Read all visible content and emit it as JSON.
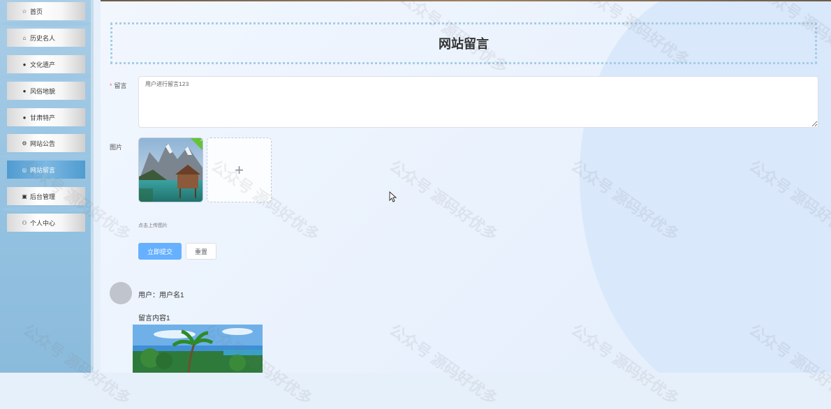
{
  "sidebar": {
    "items": [
      {
        "icon": "star-icon",
        "glyph": "☆",
        "label": "首页"
      },
      {
        "icon": "briefcase-icon",
        "glyph": "⌂",
        "label": "历史名人"
      },
      {
        "icon": "info-icon",
        "glyph": "●",
        "label": "文化遗产"
      },
      {
        "icon": "question-icon",
        "glyph": "●",
        "label": "风俗地貌"
      },
      {
        "icon": "info-icon",
        "glyph": "●",
        "label": "甘肃特产"
      },
      {
        "icon": "gear-icon",
        "glyph": "⚙",
        "label": "网站公告"
      },
      {
        "icon": "comment-icon",
        "glyph": "◎",
        "label": "网站留言",
        "active": true
      },
      {
        "icon": "box-icon",
        "glyph": "▣",
        "label": "后台管理"
      },
      {
        "icon": "user-icon",
        "glyph": "⚇",
        "label": "个人中心"
      }
    ]
  },
  "page": {
    "title": "网站留言"
  },
  "form": {
    "message_label": "留言",
    "message_required": "*",
    "message_value": "用户进行留言123",
    "image_label": "图片",
    "upload_plus": "+",
    "upload_check": "✓",
    "upload_hint": "点击上传图片",
    "submit_label": "立即提交",
    "reset_label": "重置"
  },
  "messages": [
    {
      "user": "用户：用户名1",
      "content": "留言内容1"
    }
  ],
  "watermark": "公众号 源码好优多",
  "colors": {
    "primary": "#66b1ff",
    "active_nav": "#4f9bd0",
    "success": "#67c23a"
  }
}
